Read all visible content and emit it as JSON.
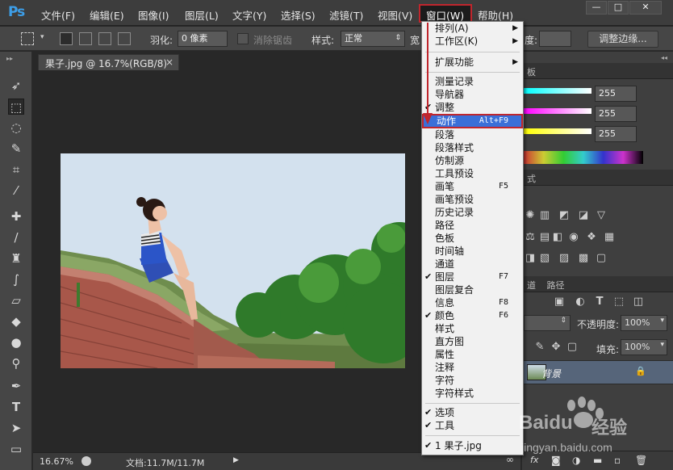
{
  "app": {
    "logo": "Ps"
  },
  "menubar": {
    "items": [
      "文件(F)",
      "编辑(E)",
      "图像(I)",
      "图层(L)",
      "文字(Y)",
      "选择(S)",
      "滤镜(T)",
      "视图(V)",
      "窗口(W)",
      "帮助(H)"
    ],
    "window_controls": [
      "—",
      "□",
      "✕"
    ]
  },
  "options": {
    "feather_label": "羽化:",
    "feather_value": "0 像素",
    "antialias_label": "消除锯齿",
    "style_label": "样式:",
    "style_value": "正常",
    "width_label_partial": "宽",
    "height_label_partial": "度:",
    "refine_button": "调整边缘..."
  },
  "document": {
    "tab_title": "果子.jpg @ 16.7%(RGB/8)",
    "tab_close": "×"
  },
  "status": {
    "zoom": "16.67%",
    "doc_size": "文档:11.7M/11.7M"
  },
  "panels": {
    "color_tab_partial": "板",
    "slider_values": [
      "255",
      "255",
      "255"
    ],
    "styles_tab_partial": "式",
    "channels_tab_partial": "道",
    "paths_tab": "路径",
    "opacity_label": "不透明度:",
    "opacity_value": "100%",
    "fill_label": "填充:",
    "fill_value": "100%",
    "layer_name": "背景",
    "fx_label": "fx"
  },
  "window_menu": {
    "items": [
      {
        "label": "排列(A)",
        "submenu": true
      },
      {
        "label": "工作区(K)",
        "submenu": true
      },
      {
        "label": "扩展功能",
        "submenu": true
      },
      {
        "label": "测量记录"
      },
      {
        "label": "导航器"
      },
      {
        "label": "调整",
        "checked": true
      },
      {
        "label": "动作",
        "shortcut": "Alt+F9",
        "highlighted": true
      },
      {
        "label": "段落"
      },
      {
        "label": "段落样式"
      },
      {
        "label": "仿制源"
      },
      {
        "label": "工具预设"
      },
      {
        "label": "画笔",
        "shortcut": "F5"
      },
      {
        "label": "画笔预设"
      },
      {
        "label": "历史记录"
      },
      {
        "label": "路径"
      },
      {
        "label": "色板"
      },
      {
        "label": "时间轴"
      },
      {
        "label": "通道"
      },
      {
        "label": "图层",
        "shortcut": "F7",
        "checked": true
      },
      {
        "label": "图层复合"
      },
      {
        "label": "信息",
        "shortcut": "F8"
      },
      {
        "label": "颜色",
        "shortcut": "F6",
        "checked": true
      },
      {
        "label": "样式"
      },
      {
        "label": "直方图"
      },
      {
        "label": "属性"
      },
      {
        "label": "注释"
      },
      {
        "label": "字符"
      },
      {
        "label": "字符样式"
      },
      {
        "label": "选项",
        "checked": true
      },
      {
        "label": "工具",
        "checked": true
      },
      {
        "label": "1 果子.jpg",
        "checked": true
      }
    ],
    "check_mark": "✔",
    "submenu_arrow": "▶"
  },
  "watermark": {
    "brand": "Baidu",
    "sub": "经验",
    "url": "jingyan.baidu.com"
  },
  "colors": {
    "highlight": "#3a6fd8",
    "annotation": "#c0262d",
    "ps_blue": "#3d9ee8"
  }
}
